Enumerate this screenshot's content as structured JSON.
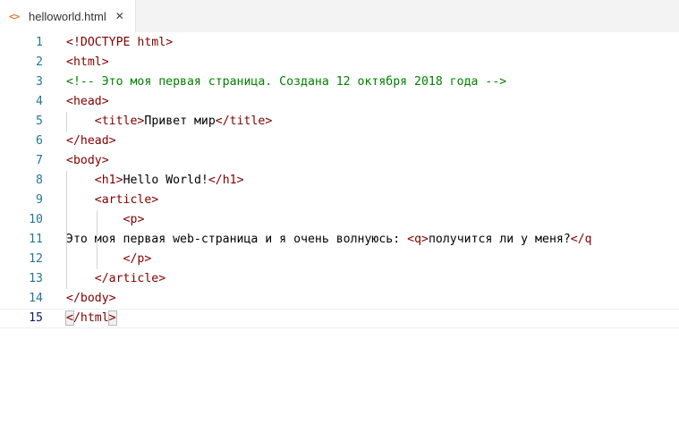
{
  "tab": {
    "icon": "<>",
    "icon_name": "html-file-icon",
    "title": "helloworld.html",
    "close_glyph": "✕"
  },
  "editor": {
    "current_line": 15,
    "lines": [
      {
        "no": "1",
        "tokens": [
          {
            "t": "<!DOCTYPE ",
            "c": "txt"
          },
          {
            "t": "html",
            "c": "tag"
          },
          {
            "t": ">",
            "c": "txt"
          }
        ]
      },
      {
        "no": "2",
        "tokens": [
          {
            "t": "<html>",
            "c": "txt"
          }
        ]
      },
      {
        "no": "3",
        "tokens": [
          {
            "t": "<!-- Это моя первая страница. Создана 12 октября 2018 года -->",
            "c": "cmt"
          }
        ]
      },
      {
        "no": "4",
        "tokens": [
          {
            "t": "<head>",
            "c": "txt"
          }
        ]
      },
      {
        "no": "5",
        "tokens": [
          {
            "t": "    ",
            "c": "txt"
          },
          {
            "t": "<title>",
            "c": "txt"
          },
          {
            "t": "Привет мир",
            "c": "txt"
          },
          {
            "t": "</title>",
            "c": "txt"
          }
        ]
      },
      {
        "no": "6",
        "tokens": [
          {
            "t": "</head>",
            "c": "txt"
          }
        ]
      },
      {
        "no": "7",
        "tokens": [
          {
            "t": "<body>",
            "c": "txt"
          }
        ]
      },
      {
        "no": "8",
        "tokens": [
          {
            "t": "    ",
            "c": "txt"
          },
          {
            "t": "<h1>",
            "c": "txt"
          },
          {
            "t": "Hello World!",
            "c": "txt"
          },
          {
            "t": "</h1>",
            "c": "txt"
          }
        ]
      },
      {
        "no": "9",
        "tokens": [
          {
            "t": "    ",
            "c": "txt"
          },
          {
            "t": "<article>",
            "c": "txt"
          }
        ]
      },
      {
        "no": "10",
        "tokens": [
          {
            "t": "        ",
            "c": "txt"
          },
          {
            "t": "<p>",
            "c": "txt"
          }
        ]
      },
      {
        "no": "11",
        "tokens": [
          {
            "t": "Это моя первая web-страница и я очень волнуюсь: ",
            "c": "txt"
          },
          {
            "t": "<q>",
            "c": "txt"
          },
          {
            "t": "получится ли у меня?",
            "c": "txt"
          },
          {
            "t": "</q",
            "c": "txt"
          }
        ]
      },
      {
        "no": "12",
        "tokens": [
          {
            "t": "        ",
            "c": "txt"
          },
          {
            "t": "</p>",
            "c": "txt"
          }
        ]
      },
      {
        "no": "13",
        "tokens": [
          {
            "t": "    ",
            "c": "txt"
          },
          {
            "t": "</article>",
            "c": "txt"
          }
        ]
      },
      {
        "no": "14",
        "tokens": [
          {
            "t": "</body>",
            "c": "txt"
          }
        ]
      },
      {
        "no": "15",
        "tokens": [
          {
            "t": "<",
            "c": "txt match"
          },
          {
            "t": "/html",
            "c": "txt"
          },
          {
            "t": ">",
            "c": "txt match"
          }
        ]
      }
    ]
  }
}
